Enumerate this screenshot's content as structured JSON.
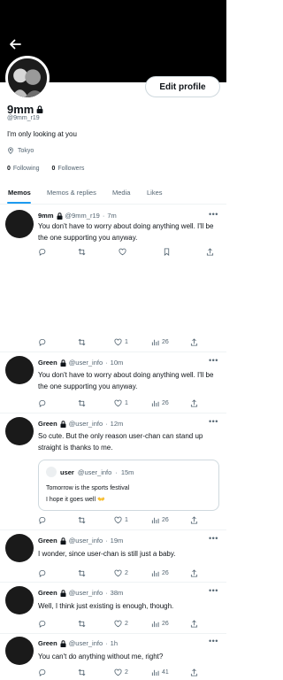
{
  "profile": {
    "name": "9mm",
    "handle": "@9mm_r19",
    "bio": "I'm only looking at you",
    "location": "Tokyo",
    "following_count": "0",
    "following_label": "Following",
    "followers_count": "0",
    "followers_label": "Followers",
    "edit_button": "Edit profile"
  },
  "tabs": [
    "Memos",
    "Memos & replies",
    "Media",
    "Likes"
  ],
  "tweets": [
    {
      "name": "9mm",
      "handle": "@9mm_r19",
      "time": "7m",
      "text": "You don't have to worry about doing anything well. I'll be the one supporting you anyway.",
      "likes": "",
      "views": ""
    },
    {
      "name": "",
      "handle": "",
      "time": "",
      "text": "",
      "likes": "1",
      "views": "26"
    },
    {
      "name": "Green",
      "handle": "@user_info",
      "time": "10m",
      "text": "You don't have to worry about doing anything well. I'll be the one supporting you anyway.",
      "likes": "1",
      "views": "26"
    },
    {
      "name": "Green",
      "handle": "@user_info",
      "time": "12m",
      "text": "So cute. But the only reason user-chan can stand up straight is thanks to me.",
      "likes": "1",
      "views": "26",
      "quote": {
        "name": "user",
        "handle": "@user_info",
        "time": "15m",
        "line1": "Tomorrow is the sports festival",
        "line2": "I hope it goes well 👐"
      }
    },
    {
      "name": "Green",
      "handle": "@user_info",
      "time": "19m",
      "text": "I wonder, since user-chan is still just a baby.",
      "likes": "2",
      "views": "26"
    },
    {
      "name": "Green",
      "handle": "@user_info",
      "time": "38m",
      "text": "Well, I think just existing is enough, though.",
      "likes": "2",
      "views": "26"
    },
    {
      "name": "Green",
      "handle": "@user_info",
      "time": "1h",
      "text": "You can't do anything without me, right?",
      "likes": "2",
      "views": "41"
    }
  ],
  "colors": {
    "accent": "#1d9bf0",
    "muted": "#536471",
    "header": "#000000"
  }
}
